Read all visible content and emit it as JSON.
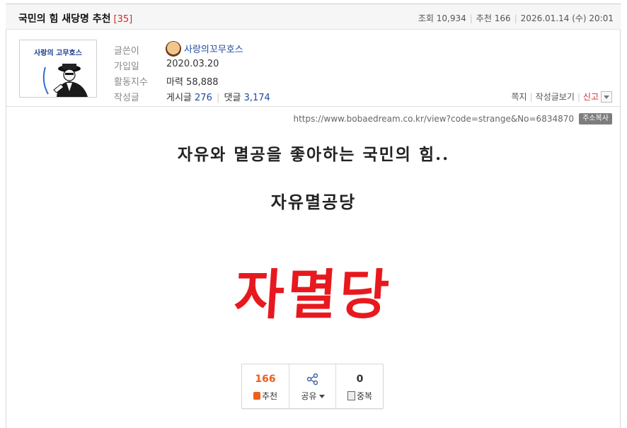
{
  "post": {
    "title": "국민의 힘 새당명 추천",
    "comment_count": "[35]",
    "views_label": "조회",
    "views": "10,934",
    "recommend_label": "추천",
    "recommend": "166",
    "datetime": "2026.01.14 (수) 20:01"
  },
  "author": {
    "avatar_text": "사랑의 고무호스",
    "nick_label": "글쓴이",
    "nickname": "사랑의꼬무호스",
    "join_label": "가입일",
    "join_date": "2020.03.20",
    "activity_label": "활동지수",
    "activity_value": "마력 58,888",
    "posts_label": "작성글",
    "posts_prefix": "게시글",
    "posts_count": "276",
    "comments_prefix": "댓글",
    "comments_count": "3,174"
  },
  "actions": {
    "message": "쪽지",
    "view_posts": "작성글보기",
    "report": "신고"
  },
  "url": {
    "text": "https://www.bobaedream.co.kr/view?code=strange&No=6834870",
    "copy_label": "주소복사"
  },
  "content": {
    "line1": "자유와 멸공을 좋아하는 국민의 힘..",
    "line2": "자유멸공당",
    "big": "자멸당"
  },
  "vote": {
    "recommend_count": "166",
    "recommend_label": "추천",
    "share_label": "공유",
    "duplicate_count": "0",
    "duplicate_label": "중복"
  },
  "colors": {
    "accent_red": "#e8191e",
    "link_blue": "#1f4ba0",
    "recommend_orange": "#ef5f1b"
  }
}
